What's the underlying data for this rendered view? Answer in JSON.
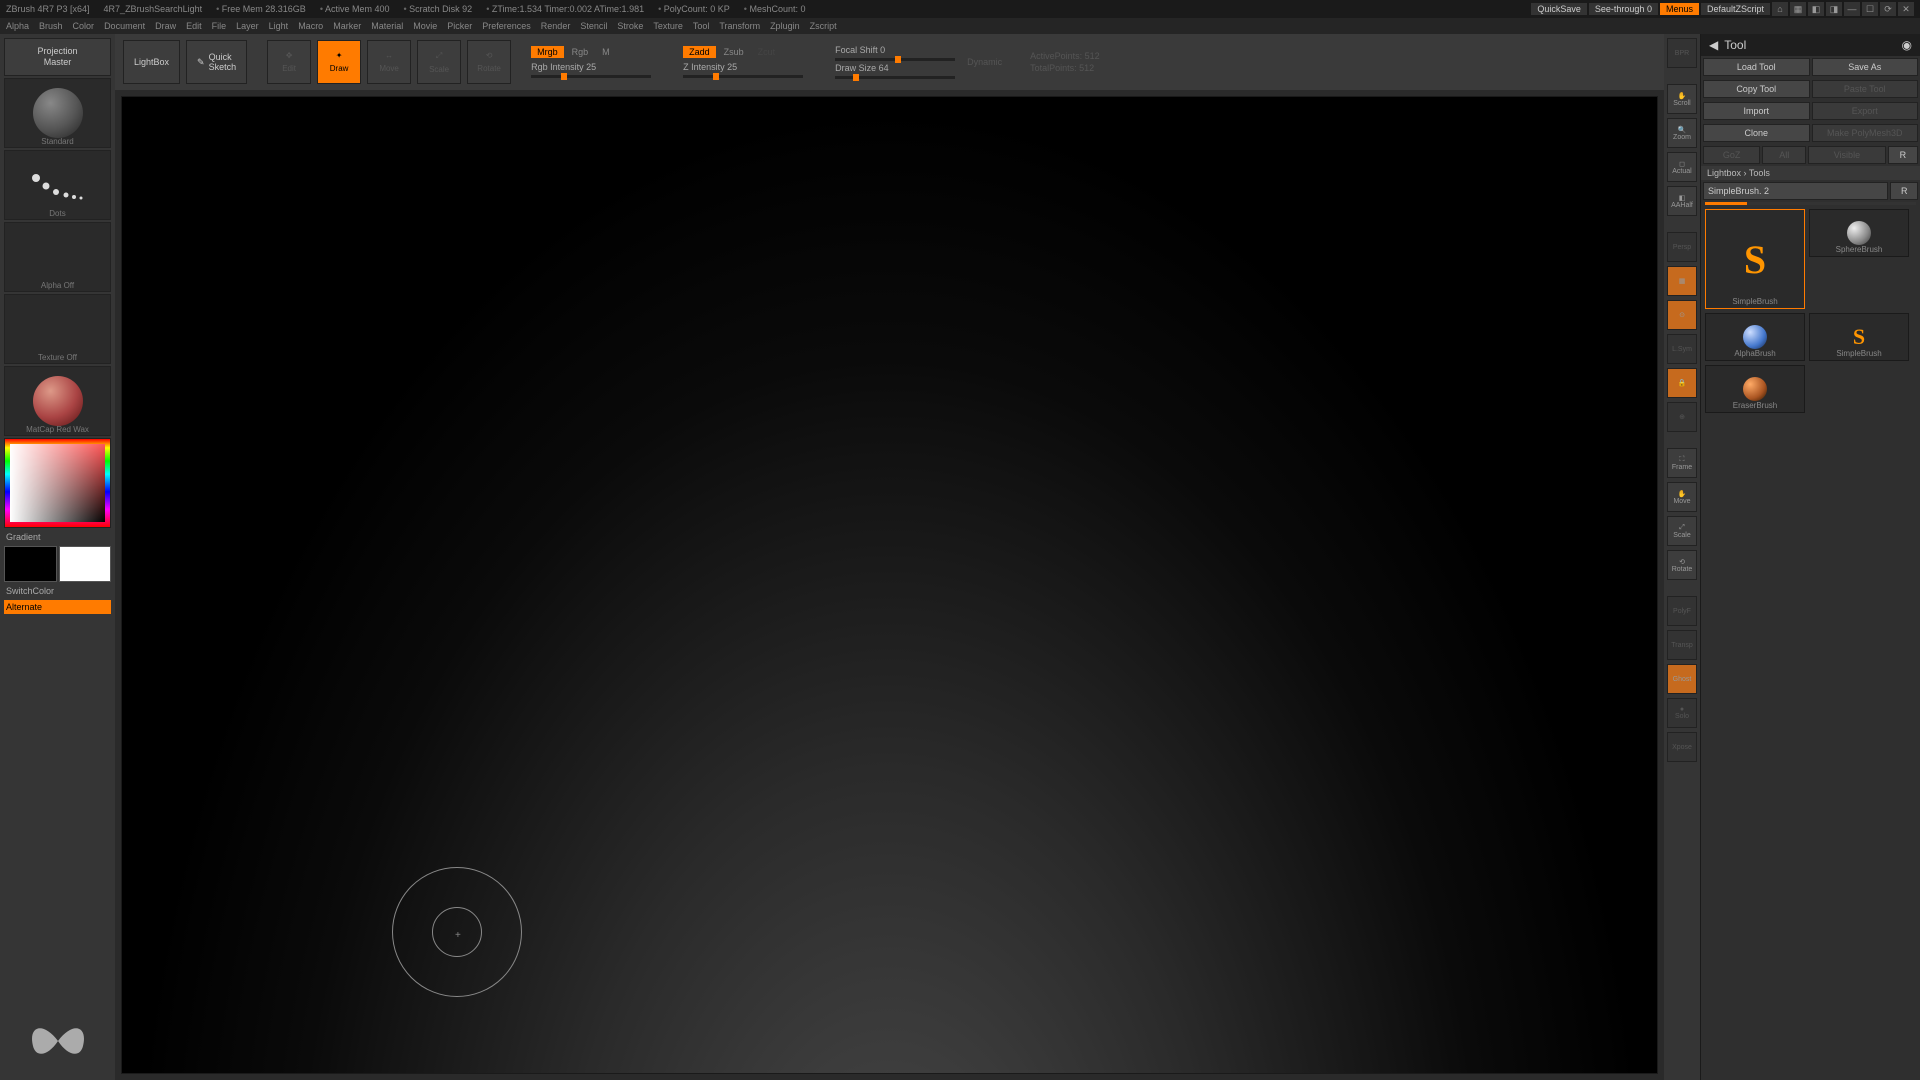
{
  "title": {
    "app": "ZBrush 4R7 P3 [x64]",
    "doc": "4R7_ZBrushSearchLight",
    "freemem": "Free Mem 28.316GB",
    "activemem": "Active Mem 400",
    "scratch": "Scratch Disk 92",
    "ztime": "ZTime:1.534 Timer:0.002 ATime:1.981",
    "polycount": "PolyCount: 0 KP",
    "meshcount": "MeshCount: 0",
    "quicksave": "QuickSave",
    "seethrough": "See-through  0",
    "menus": "Menus",
    "script": "DefaultZScript"
  },
  "menu": [
    "Alpha",
    "Brush",
    "Color",
    "Document",
    "Draw",
    "Edit",
    "File",
    "Layer",
    "Light",
    "Macro",
    "Marker",
    "Material",
    "Movie",
    "Picker",
    "Preferences",
    "Render",
    "Stencil",
    "Stroke",
    "Texture",
    "Tool",
    "Transform",
    "Zplugin",
    "Zscript"
  ],
  "left": {
    "projection": "Projection\nMaster",
    "lightbox": "LightBox",
    "quicksketch": "Quick\nSketch",
    "brush_lbl": "Standard",
    "stroke_lbl": "Dots",
    "alpha_lbl": "Alpha Off",
    "texture_lbl": "Texture Off",
    "material_lbl": "MatCap Red Wax",
    "gradient": "Gradient",
    "switchcolor": "SwitchColor",
    "alternate": "Alternate"
  },
  "top": {
    "edit": "Edit",
    "draw": "Draw",
    "move": "Move",
    "scale": "Scale",
    "rotate": "Rotate",
    "mrgb": "Mrgb",
    "rgb": "Rgb",
    "m": "M",
    "rgbint_lbl": "Rgb Intensity",
    "rgbint_val": "25",
    "zadd": "Zadd",
    "zsub": "Zsub",
    "zcut": "Zcut",
    "zint_lbl": "Z Intensity",
    "zint_val": "25",
    "focal_lbl": "Focal Shift",
    "focal_val": "0",
    "draw_lbl": "Draw Size",
    "draw_val": "64",
    "dynamic": "Dynamic",
    "ap": "ActivePoints: 512",
    "tp": "TotalPoints: 512"
  },
  "rr": {
    "bpr": "BPR",
    "scroll": "Scroll",
    "zoom": "Zoom",
    "actual": "Actual",
    "aahalf": "AAHalf",
    "persp": "Persp",
    "floor": "Floor",
    "local": "Local",
    "lc": "L.Sym",
    "frame": "Frame",
    "move": "Move",
    "scale": "Scale",
    "rotate": "Rotate",
    "pf": "PolyF",
    "transp": "Transp",
    "ghost": "Ghost",
    "solo": "Solo",
    "xpose": "Xpose"
  },
  "rp": {
    "title": "Tool",
    "load": "Load Tool",
    "save": "Save As",
    "copy": "Copy Tool",
    "paste": "Paste Tool",
    "import": "Import",
    "export": "Export",
    "clone": "Clone",
    "makepm": "Make PolyMesh3D",
    "goz": "GoZ",
    "all": "All",
    "visible": "Visible",
    "r1": "R",
    "lightboxtools": "Lightbox › Tools",
    "toolname": "SimpleBrush. 2",
    "r2": "R",
    "tools": {
      "t0": "SimpleBrush",
      "t1": "SphereBrush",
      "t2": "SimpleBrush",
      "t3": "AlphaBrush",
      "t4": "EraserBrush"
    }
  }
}
